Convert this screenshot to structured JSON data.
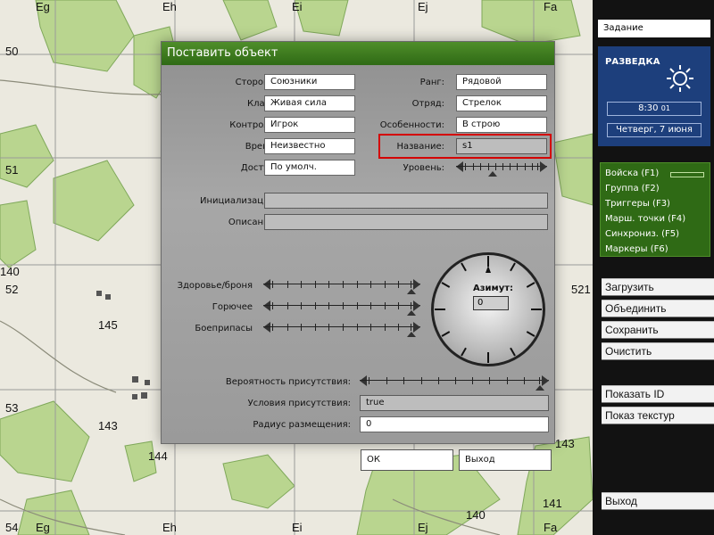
{
  "map": {
    "col_labels": [
      "Eg",
      "Eh",
      "Ei",
      "Ej",
      "Fa"
    ],
    "row_labels": [
      "50",
      "51",
      "52",
      "53",
      "54"
    ],
    "elevation_labels": [
      "140",
      "145",
      "143",
      "143",
      "144",
      "141",
      "140",
      "521"
    ],
    "bottom_labels": [
      "Eg",
      "Eh",
      "Ei",
      "Ej",
      "Fa"
    ]
  },
  "dialog": {
    "title": "Поставить объект",
    "side_label": "Сторона:",
    "side_value": "Союзники",
    "class_label": "Класс:",
    "class_value": "Живая сила",
    "control_label": "Контроль:",
    "control_value": "Игрок",
    "time_label": "Время:",
    "time_value": "Неизвестно",
    "access_label": "Доступ:",
    "access_value": "По умолч.",
    "rank_label": "Ранг:",
    "rank_value": "Рядовой",
    "squad_label": "Отряд:",
    "squad_value": "Стрелок",
    "special_label": "Особенности:",
    "special_value": "В строю",
    "name_label": "Название:",
    "name_value": "s1",
    "level_label": "Уровень:",
    "init_label": "Инициализация:",
    "init_value": "",
    "desc_label": "Описание:",
    "desc_value": "",
    "health_label": "Здоровье/броня",
    "fuel_label": "Горючее",
    "ammo_label": "Боеприпасы",
    "azimuth_label": "Азимут:",
    "azimuth_value": "0",
    "prob_label": "Вероятность присутствия:",
    "cond_label": "Условия присутствия:",
    "cond_value": "true",
    "radius_label": "Радиус размещения:",
    "radius_value": "0",
    "ok_label": "ОК",
    "exit_label": "Выход",
    "levels": {
      "skill": 0.38,
      "health": 1.0,
      "fuel": 1.0,
      "ammo": 1.0,
      "probability": 1.0
    }
  },
  "panel": {
    "task_label": "Задание",
    "recon_title": "РАЗВЕДКА",
    "weather_icon": "sun-icon",
    "time": "8:30",
    "time_seconds": "01",
    "date": "Четверг, 7 июня",
    "modes": [
      "Войска (F1)",
      "Группа (F2)",
      "Триггеры (F3)",
      "Марш. точки (F4)",
      "Синхрониз. (F5)",
      "Маркеры (F6)"
    ],
    "load": "Загрузить",
    "merge": "Объединить",
    "save": "Сохранить",
    "clear": "Очистить",
    "show_id": "Показать ID",
    "show_textures": "Показ текстур",
    "exit": "Выход"
  }
}
